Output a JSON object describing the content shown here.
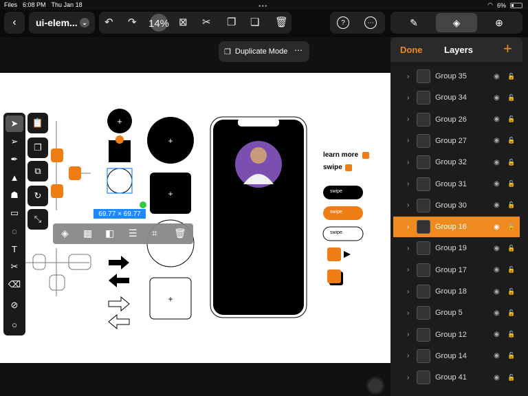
{
  "status": {
    "app": "Files",
    "time": "6:08 PM",
    "date": "Thu Jan 18",
    "battery": "6%"
  },
  "toolbar": {
    "back_icon": "chevron-left-icon",
    "doc_title": "ui-elem...",
    "zoom": "14%"
  },
  "duplicate_mode": {
    "label": "Duplicate Mode"
  },
  "layers_panel": {
    "done": "Done",
    "title": "Layers",
    "add": "+",
    "items": [
      {
        "name": "Group 35",
        "selected": false
      },
      {
        "name": "Group 34",
        "selected": false
      },
      {
        "name": "Group 26",
        "selected": false
      },
      {
        "name": "Group 27",
        "selected": false
      },
      {
        "name": "Group 32",
        "selected": false
      },
      {
        "name": "Group 31",
        "selected": false
      },
      {
        "name": "Group 30",
        "selected": false
      },
      {
        "name": "Group 16",
        "selected": true
      },
      {
        "name": "Group 19",
        "selected": false
      },
      {
        "name": "Group 17",
        "selected": false
      },
      {
        "name": "Group 18",
        "selected": false
      },
      {
        "name": "Group 5",
        "selected": false
      },
      {
        "name": "Group 12",
        "selected": false
      },
      {
        "name": "Group 14",
        "selected": false
      },
      {
        "name": "Group 41",
        "selected": false
      }
    ]
  },
  "canvas": {
    "selection_size": "69.77 × 69.77",
    "learn_more": "learn more",
    "swipe": "swipe",
    "swipe_buttons": [
      "swipe",
      "swipe",
      "swipe"
    ]
  },
  "colors": {
    "accent": "#ee8a20",
    "selection": "#1e88ff"
  }
}
